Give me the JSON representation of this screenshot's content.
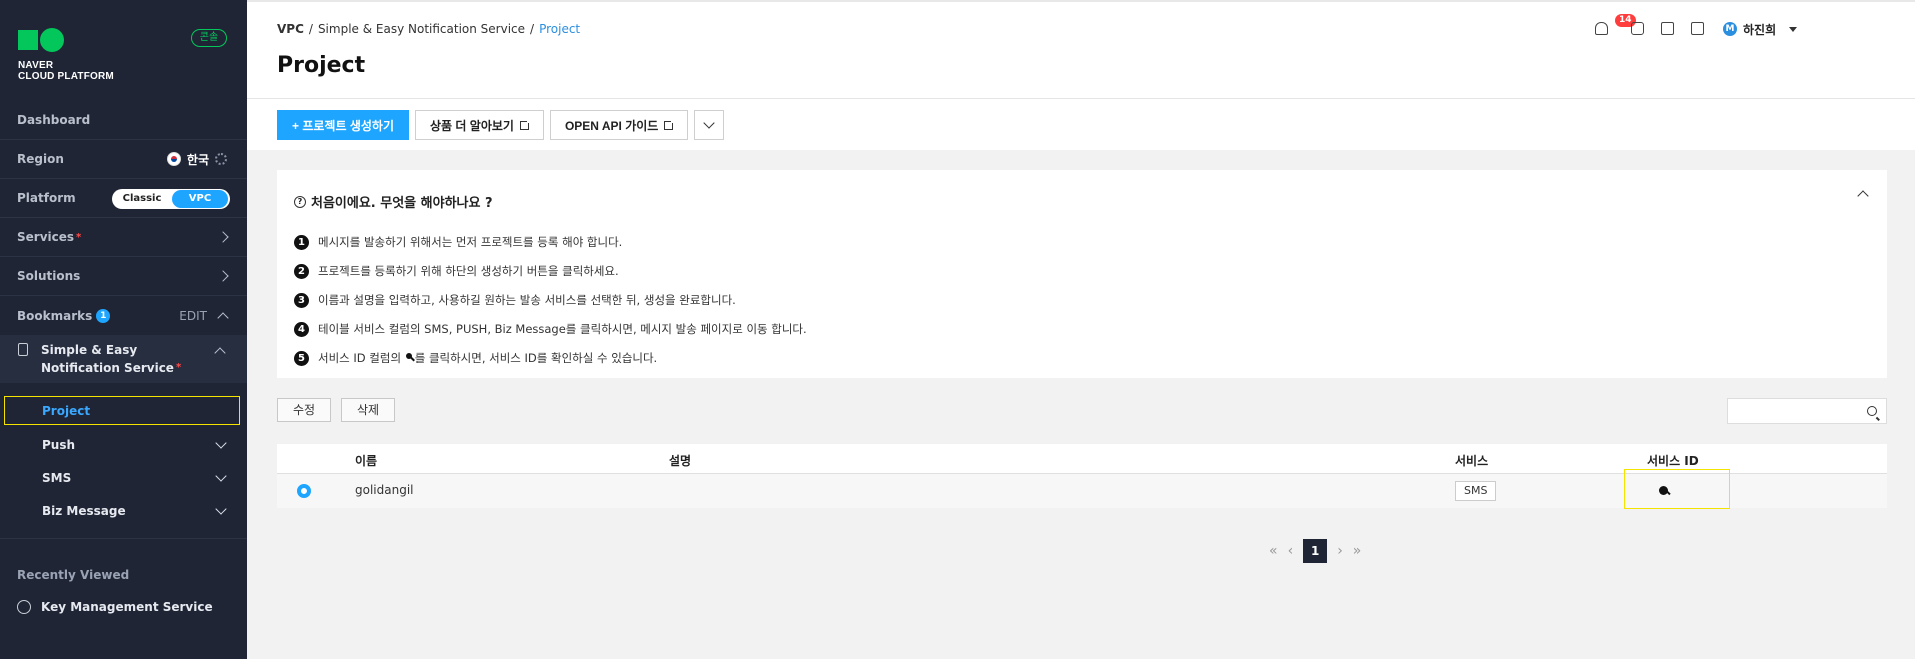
{
  "sidebar": {
    "logo_line1": "NAVER",
    "logo_line2": "CLOUD PLATFORM",
    "console_badge": "콘솔",
    "dashboard": "Dashboard",
    "region_label": "Region",
    "region_value": "한국",
    "platform_label": "Platform",
    "platform_classic": "Classic",
    "platform_vpc": "VPC",
    "services": "Services",
    "solutions": "Solutions",
    "bookmarks": "Bookmarks",
    "bookmarks_count": "1",
    "edit": "EDIT",
    "sens_label": "Simple & Easy Notification Service",
    "sub_items": [
      "Project",
      "Push",
      "SMS",
      "Biz Message"
    ],
    "recently_viewed": "Recently Viewed",
    "recent_item": "Key Management Service"
  },
  "header": {
    "breadcrumb": [
      "VPC",
      "/",
      "Simple & Easy Notification Service",
      "/",
      "Project"
    ],
    "title": "Project",
    "notification_count": "14",
    "user_initial": "M",
    "user_name": "하진희"
  },
  "toolbar": {
    "create": "+ 프로젝트 생성하기",
    "learn_more": "상품 더 알아보기",
    "api_guide": "OPEN API 가이드"
  },
  "guide": {
    "title": "처음이에요. 무엇을 해야하나요 ?",
    "steps": [
      "메시지를 발송하기 위해서는 먼저 프로젝트를 등록 해야 합니다.",
      "프로젝트를 등록하기 위해 하단의 생성하기 버튼을 클릭하세요.",
      "이름과 설명을 입력하고, 사용하길 원하는 발송 서비스를 선택한 뒤, 생성을 완료합니다.",
      "테이블 서비스 컬럼의 SMS, PUSH, Biz Message를 클릭하시면, 메시지 발송 페이지로 이동 합니다.",
      "서비스 ID 컬럼의 ",
      "를 클릭하시면, 서비스 ID를 확인하실 수 있습니다."
    ]
  },
  "actions": {
    "edit": "수정",
    "delete": "삭제"
  },
  "table": {
    "headers": [
      "이름",
      "설명",
      "서비스",
      "서비스 ID"
    ],
    "rows": [
      {
        "name": "golidangil",
        "description": "",
        "service": "SMS"
      }
    ]
  },
  "pagination": {
    "current": "1",
    "first": "«",
    "prev": "‹",
    "next": "›",
    "last": "»"
  }
}
